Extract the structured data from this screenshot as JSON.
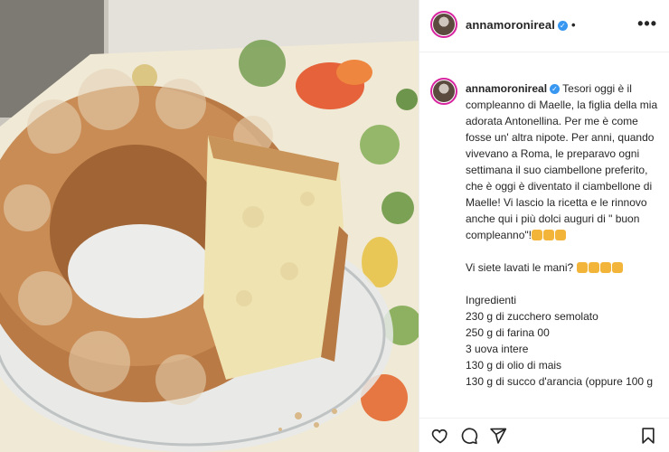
{
  "post": {
    "username": "annamoronireal",
    "header_dot": "•",
    "more_label": "•••",
    "caption_lines": [
      "Tesori oggi è il",
      "compleanno di Maelle, la figlia della mia",
      "adorata Antonellina. Per me è come",
      "fosse un' altra nipote. Per anni, quando",
      "vivevano a Roma, le preparavo ogni",
      "settimana il suo ciambellone preferito,",
      "che è oggi è diventato il ciambellone di",
      "Maelle! Vi lascio la ricetta e le rinnovo",
      "anche qui i più dolci auguri di \" buon",
      "compleanno\"!"
    ],
    "question": "Vi siete lavati le mani?",
    "ingredients_title": "Ingredienti",
    "ingredients": [
      "230 g di zucchero semolato",
      "250 g di farina 00",
      "3 uova intere",
      "130 g di olio di mais",
      "130 g di succo d'arancia (oppure 100 g"
    ]
  },
  "icons": [
    "heart-icon",
    "comment-icon",
    "share-icon",
    "bookmark-icon",
    "more-icon",
    "verified-icon"
  ],
  "colors": {
    "verified": "#3897f0",
    "text": "#262626",
    "divider": "#efefef"
  }
}
